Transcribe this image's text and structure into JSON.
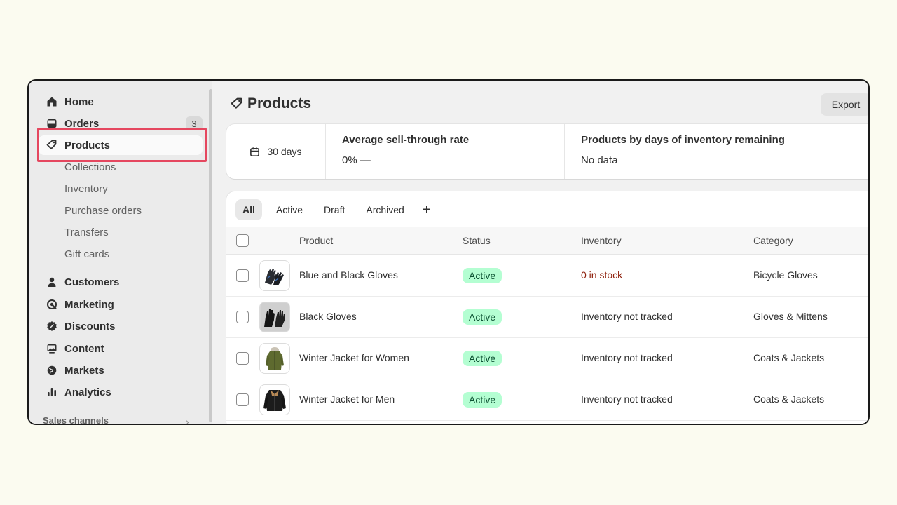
{
  "sidebar": {
    "items": [
      {
        "label": "Home",
        "icon": "home-icon"
      },
      {
        "label": "Orders",
        "icon": "inbox-icon",
        "badge": "3"
      },
      {
        "label": "Products",
        "icon": "tag-icon"
      }
    ],
    "sub_items": [
      "Collections",
      "Inventory",
      "Purchase orders",
      "Transfers",
      "Gift cards"
    ],
    "items2": [
      {
        "label": "Customers",
        "icon": "person-icon"
      },
      {
        "label": "Marketing",
        "icon": "target-icon"
      },
      {
        "label": "Discounts",
        "icon": "discount-icon"
      },
      {
        "label": "Content",
        "icon": "image-icon"
      },
      {
        "label": "Markets",
        "icon": "globe-icon"
      },
      {
        "label": "Analytics",
        "icon": "bar-chart-icon"
      }
    ],
    "sales_channels": "Sales channels"
  },
  "header": {
    "title": "Products",
    "export_label": "Export"
  },
  "stats": {
    "date_range": "30 days",
    "sell_through_label": "Average sell-through rate",
    "sell_through_value": "0%  —",
    "days_inventory_label": "Products by days of inventory remaining",
    "days_inventory_value": "No data"
  },
  "tabs": [
    "All",
    "Active",
    "Draft",
    "Archived",
    "+"
  ],
  "table": {
    "columns": [
      "Product",
      "Status",
      "Inventory",
      "Category"
    ],
    "rows": [
      {
        "product": "Blue and Black Gloves",
        "status": "Active",
        "inventory": "0 in stock",
        "category": "Bicycle Gloves"
      },
      {
        "product": "Black Gloves",
        "status": "Active",
        "inventory": "Inventory not tracked",
        "category": "Gloves & Mittens"
      },
      {
        "product": "Winter Jacket for Women",
        "status": "Active",
        "inventory": "Inventory not tracked",
        "category": "Coats & Jackets"
      },
      {
        "product": "Winter Jacket for Men",
        "status": "Active",
        "inventory": "Inventory not tracked",
        "category": "Coats & Jackets"
      }
    ]
  },
  "colors": {
    "highlight": "#e5475f",
    "active_badge_bg": "#b4fed2",
    "active_badge_text": "#0c5132",
    "out_of_stock": "#8e1f0b"
  }
}
